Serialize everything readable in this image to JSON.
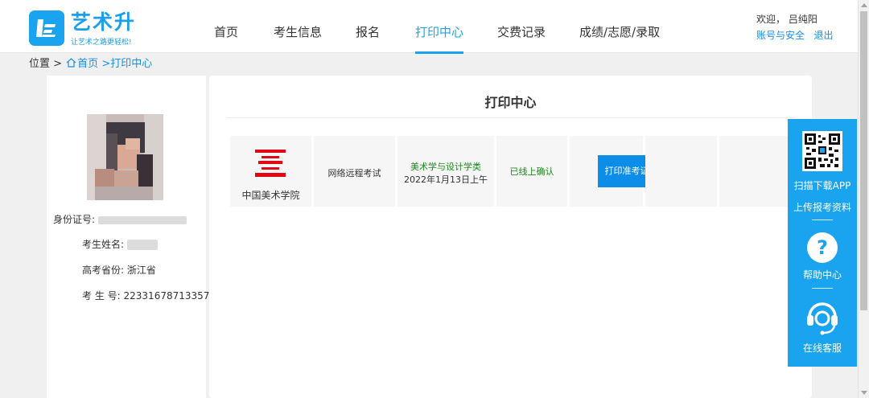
{
  "logo": {
    "title": "艺术升",
    "slogan": "让艺术之路更轻松!",
    "icon": "brand-logo-icon",
    "color": "#1aa4f0"
  },
  "nav": {
    "items": [
      {
        "label": "首页"
      },
      {
        "label": "考生信息"
      },
      {
        "label": "报名"
      },
      {
        "label": "打印中心",
        "active": true
      },
      {
        "label": "交费记录"
      },
      {
        "label": "成绩/志愿/录取"
      }
    ]
  },
  "user": {
    "welcome": "欢迎，",
    "name": "吕纯阳",
    "account_link": "账号与安全",
    "logout_link": "退出"
  },
  "breadcrumb": {
    "prefix": "位置 >",
    "home": "首页",
    "sep": ">",
    "current": "打印中心",
    "icon": "home-icon"
  },
  "profile": {
    "id_label": "身份证号:",
    "name_label": "考生姓名:",
    "province_label": "高考省份:",
    "province_value": "浙江省",
    "exam_no_label": "考 生 号:",
    "exam_no_value": "22331678713357"
  },
  "main": {
    "title": "打印中心",
    "record": {
      "school": "中国美术学院",
      "exam_type": "网络远程考试",
      "category": "美术学与设计学类",
      "date": "2022年1月13日上午",
      "status": "已线上确认",
      "action": "打印准考证",
      "category_color": "#1b8a1b",
      "status_color": "#1b8a1b",
      "school_logo_color": "#e30613"
    }
  },
  "floatbar": {
    "download_app": "扫描下载APP",
    "upload": "上传报考资料",
    "help": "帮助中心",
    "service": "在线客服",
    "icons": [
      "qr-code-icon",
      "help-icon",
      "headset-icon"
    ]
  }
}
